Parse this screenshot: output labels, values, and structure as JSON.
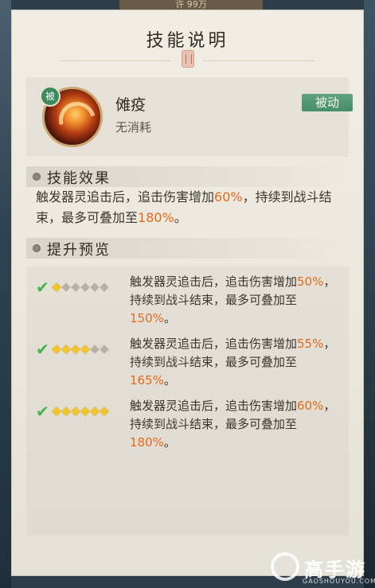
{
  "top_peek_text": "许 99万",
  "panel": {
    "title": "技能说明"
  },
  "skill": {
    "badge": "被",
    "name": "傩疫",
    "cost": "无消耗",
    "type_label": "被动"
  },
  "effect": {
    "header": "技能效果",
    "text_part1": "触发器灵追击后，追击伤害增加",
    "value1": "60%",
    "text_part2": "，持续到战斗结束，最多可叠加至",
    "value2": "180%",
    "text_part3": "。"
  },
  "preview": {
    "header": "提升预览",
    "rows": [
      {
        "stars_lit": 1,
        "stars_total": 6,
        "text_part1": "触发器灵追击后，追击伤害增加",
        "value1": "50%",
        "text_part2": "，持续到战斗结束，最多可叠加至",
        "value2": "150%",
        "text_part3": "。"
      },
      {
        "stars_lit": 4,
        "stars_total": 6,
        "text_part1": "触发器灵追击后，追击伤害增加",
        "value1": "55%",
        "text_part2": "，持续到战斗结束，最多可叠加至",
        "value2": "165%",
        "text_part3": "。"
      },
      {
        "stars_lit": 6,
        "stars_total": 6,
        "text_part1": "触发器灵追击后，追击伤害增加",
        "value1": "60%",
        "text_part2": "，持续到战斗结束，最多可叠加至",
        "value2": "180%",
        "text_part3": "。"
      }
    ]
  },
  "watermark": {
    "brand": "高手游",
    "url": "GAOSHOUYOU.COM"
  },
  "colors": {
    "highlight": "#e36a1c",
    "passive_tag": "#468d6a",
    "star_on": "#f2c52b",
    "check": "#46b049"
  }
}
